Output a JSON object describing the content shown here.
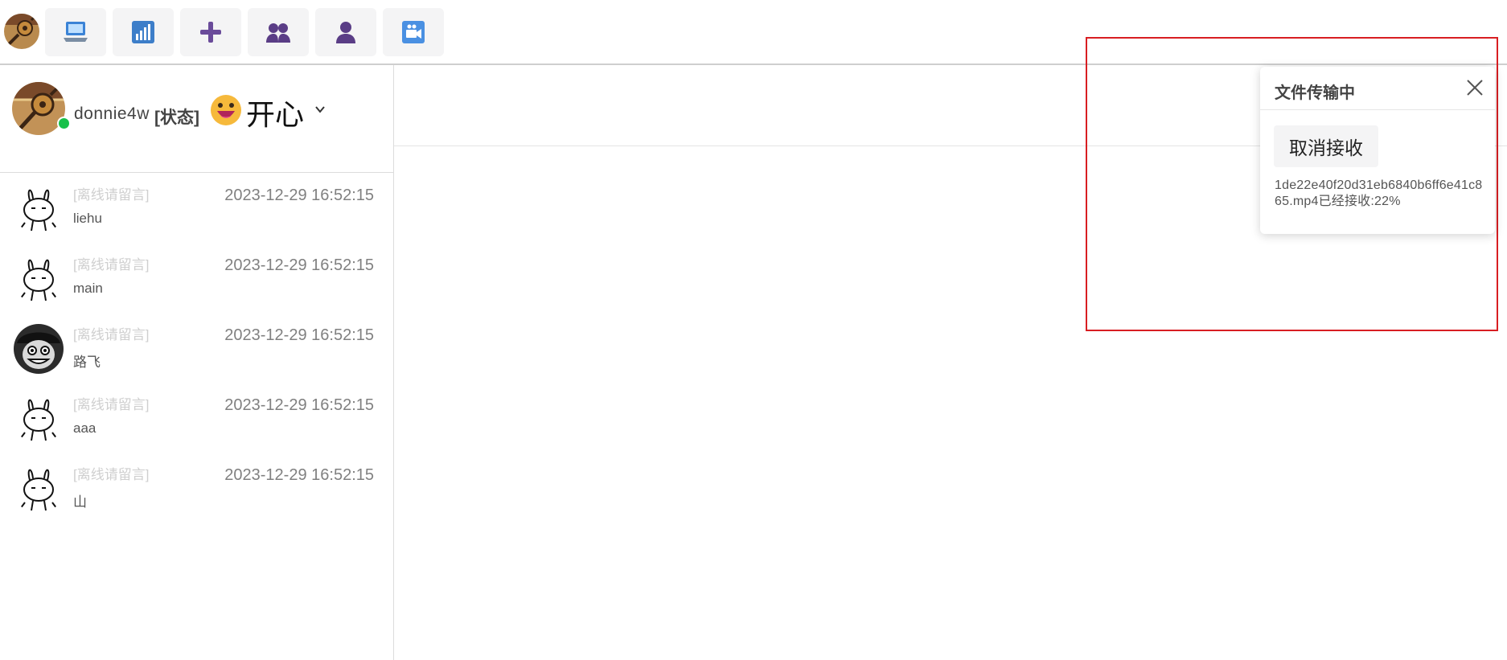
{
  "toolbar": {
    "avatar_icon": "guitar-avatar-icon",
    "buttons": [
      {
        "icon": "computer-icon",
        "color": "#3b83d6"
      },
      {
        "icon": "bar-chart-icon",
        "color": "#3d7ec9"
      },
      {
        "icon": "plus-icon",
        "color": "#6a4b9a"
      },
      {
        "icon": "group-icon",
        "color": "#5a3d86"
      },
      {
        "icon": "user-icon",
        "color": "#5a3d86"
      },
      {
        "icon": "video-icon",
        "color": "#4a90e2"
      }
    ]
  },
  "profile": {
    "username": "donnie4w",
    "status_tag": "[状态]",
    "mood_emoji_icon": "grinning-face-icon",
    "mood_text": "开心",
    "online": true,
    "online_color": "#18c04a"
  },
  "contacts": [
    {
      "status": "[离线请留言]",
      "name": "liehu",
      "time": "2023-12-29 16:52:15",
      "avatar": "rabbit-avatar-icon"
    },
    {
      "status": "[离线请留言]",
      "name": "main",
      "time": "2023-12-29 16:52:15",
      "avatar": "rabbit-avatar-icon"
    },
    {
      "status": "[离线请留言]",
      "name": "路飞",
      "time": "2023-12-29 16:52:15",
      "avatar": "luffy-avatar-icon"
    },
    {
      "status": "[离线请留言]",
      "name": "aaa",
      "time": "2023-12-29 16:52:15",
      "avatar": "rabbit-avatar-icon"
    },
    {
      "status": "[离线请留言]",
      "name": "山",
      "time": "2023-12-29 16:52:15",
      "avatar": "rabbit-avatar-icon"
    }
  ],
  "transfer_popup": {
    "title": "文件传输中",
    "cancel_label": "取消接收",
    "info": "1de22e40f20d31eb6840b6ff6e41c865.mp4已经接收:22%",
    "progress_percent": 22,
    "highlight_color": "#d81e22"
  }
}
